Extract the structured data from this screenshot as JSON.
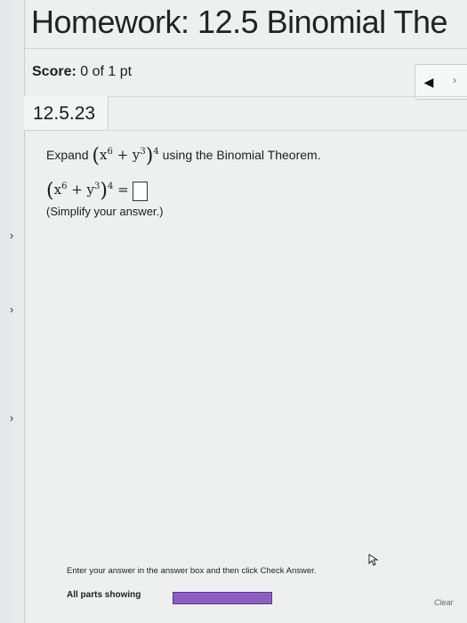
{
  "header": {
    "title": "Homework: 12.5 Binomial The"
  },
  "score": {
    "label": "Score:",
    "value": "0 of 1 pt"
  },
  "nav": {
    "prev_icon": "left-triangle-icon",
    "next_icon": "right-arrow-icon"
  },
  "problem": {
    "id": "12.5.23",
    "prompt_before": "Expand",
    "prompt_after": "using the Binomial Theorem.",
    "instruction": "(Simplify your answer.)"
  },
  "footer": {
    "help_text": "Enter your answer in the answer box and then click Check Answer.",
    "parts_label": "All parts showing",
    "progress": 1.0,
    "clear_label": "Clear"
  },
  "colors": {
    "progress": "#8c5ec2",
    "background": "#eef0ef"
  }
}
